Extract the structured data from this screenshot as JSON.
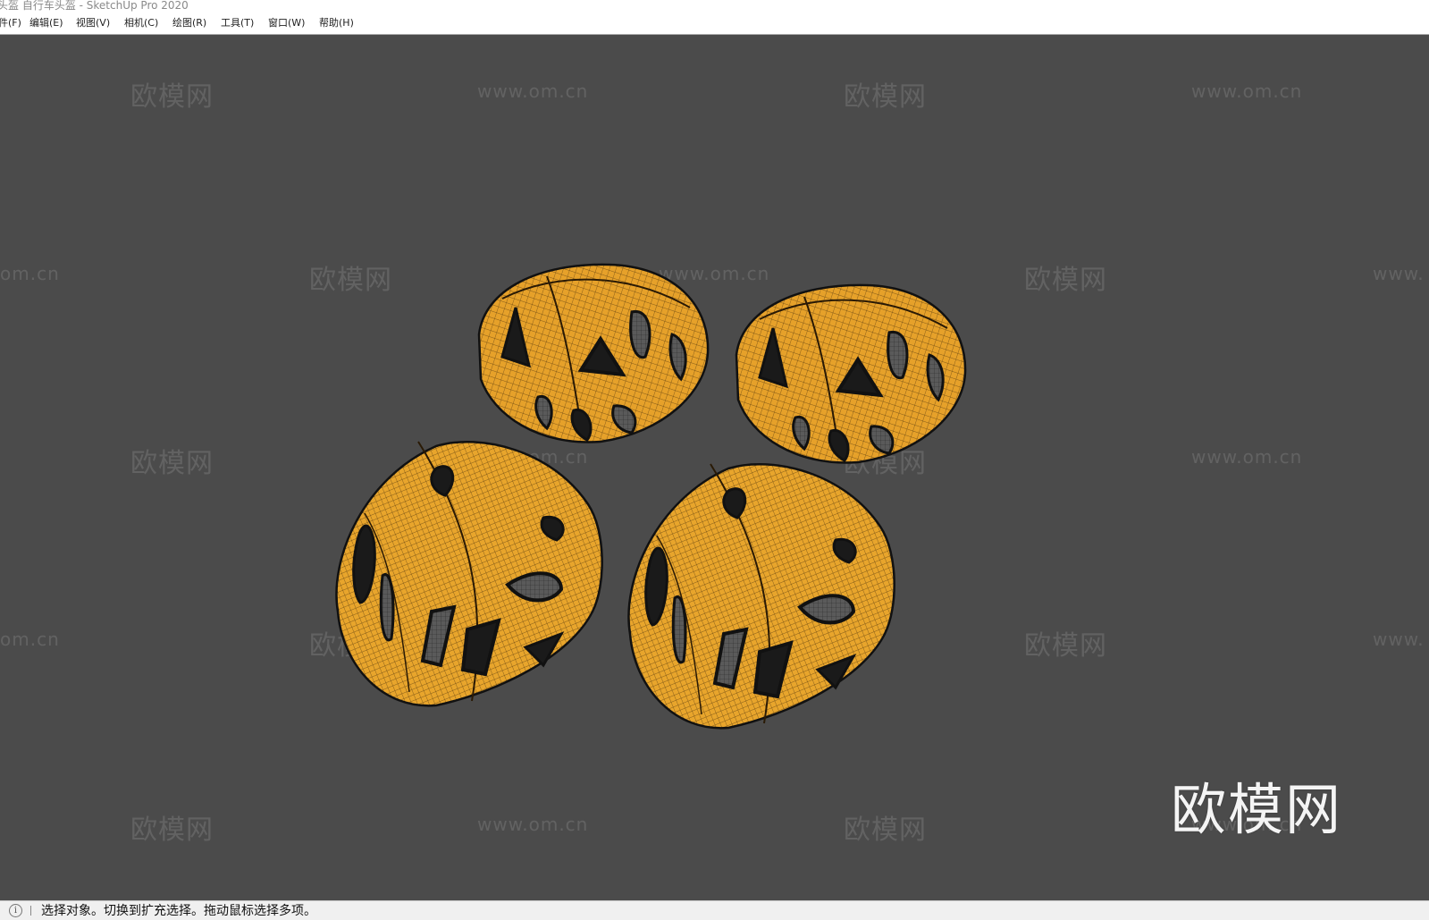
{
  "window": {
    "title": "头盔 自行车头盔 - SketchUp Pro 2020"
  },
  "menu": {
    "items": [
      {
        "label": "件(F)"
      },
      {
        "label": "编辑(E)"
      },
      {
        "label": "视图(V)"
      },
      {
        "label": "相机(C)"
      },
      {
        "label": "绘图(R)"
      },
      {
        "label": "工具(T)"
      },
      {
        "label": "窗口(W)"
      },
      {
        "label": "帮助(H)"
      }
    ]
  },
  "viewport": {
    "background_color": "#4b4b4b",
    "model_color": "#e6a12a",
    "watermark_cn": "欧模网",
    "watermark_url": "www.om.cn",
    "watermark_url_left": "om.cn",
    "watermark_url_right": "www.",
    "brand_logo": "欧模网"
  },
  "statusbar": {
    "icon": "info-icon",
    "text": "选择对象。切换到扩充选择。拖动鼠标选择多项。"
  }
}
